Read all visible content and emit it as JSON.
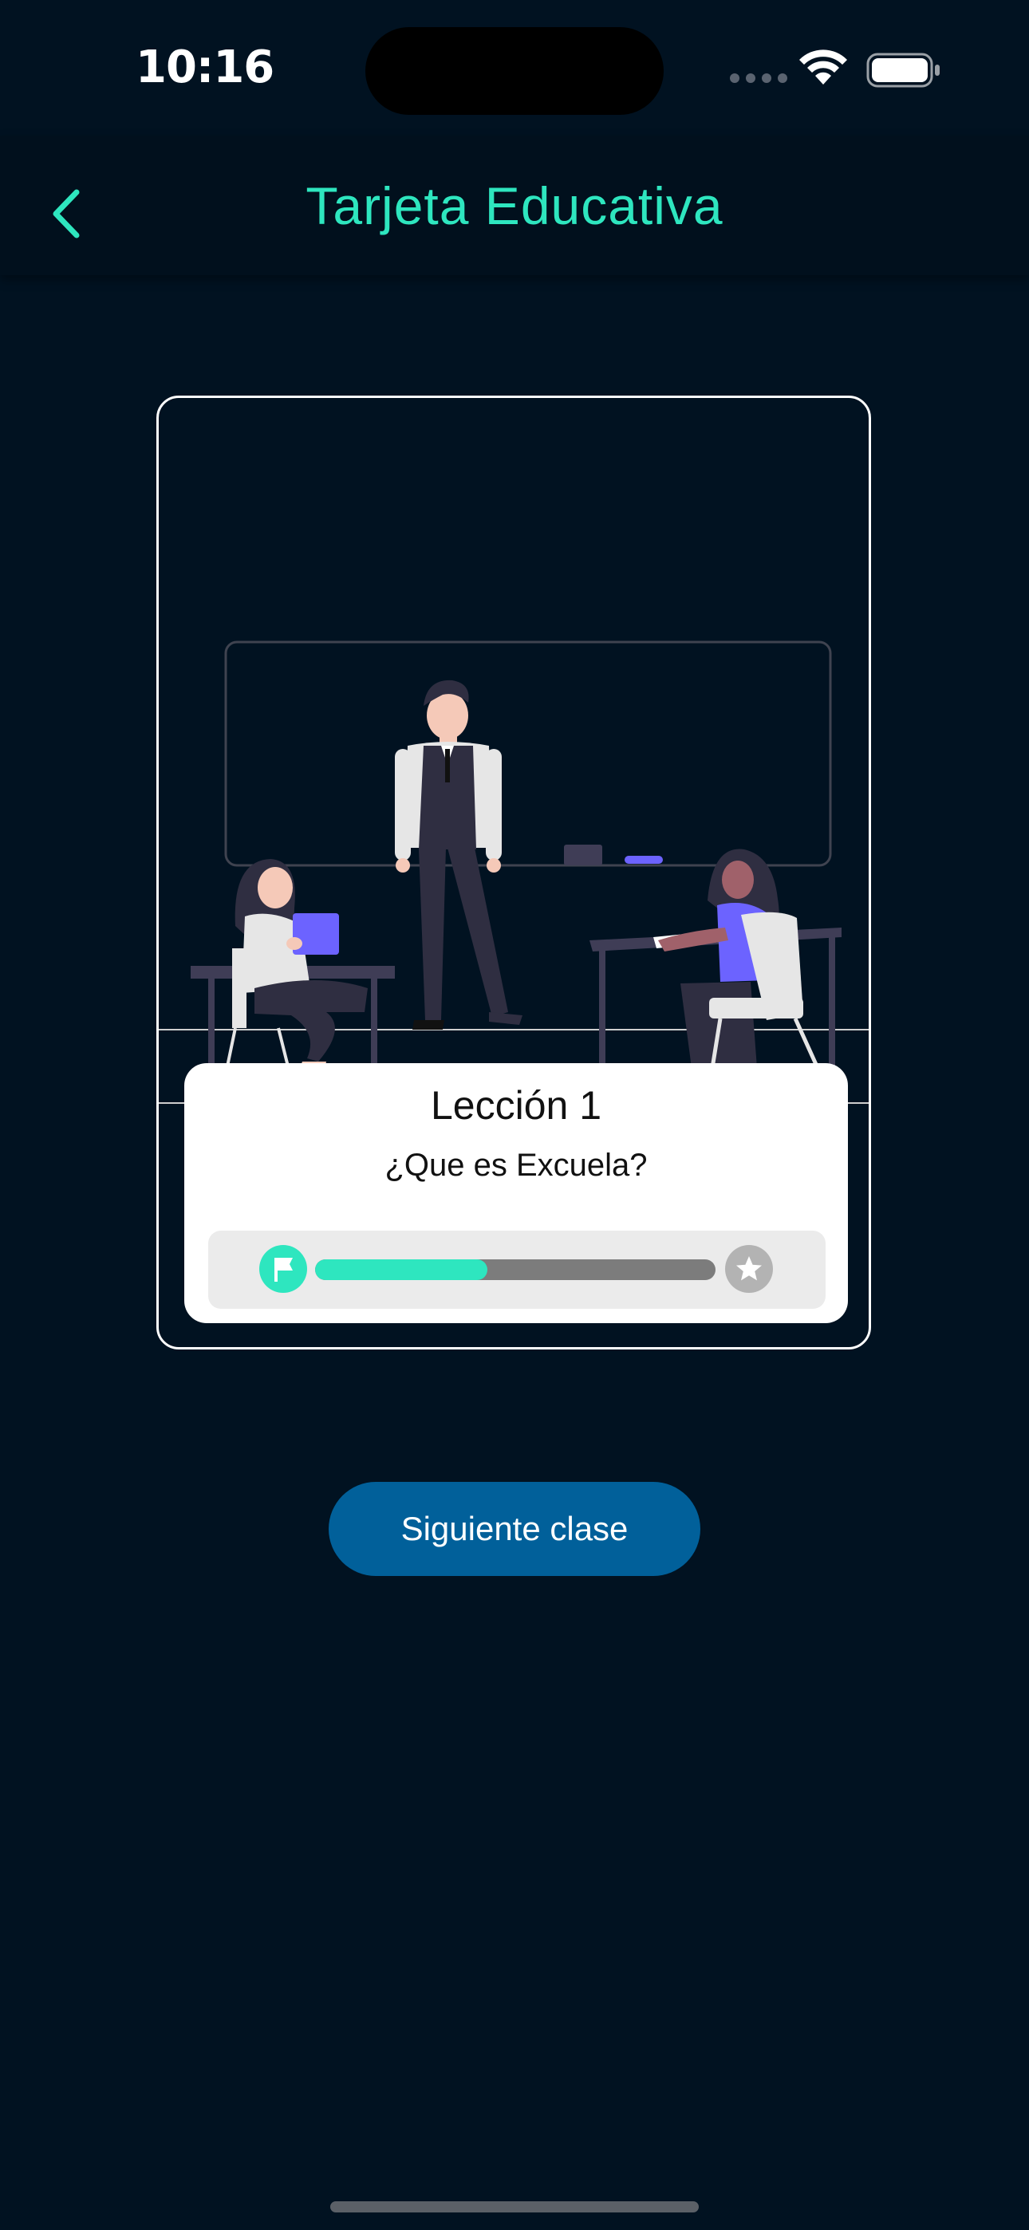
{
  "status_bar": {
    "time": "10:16",
    "wifi_icon": "wifi-icon",
    "battery_icon": "battery-icon"
  },
  "nav": {
    "back_icon": "chevron-left-icon",
    "title": "Tarjeta Educativa"
  },
  "card": {
    "illustration": "classroom-illustration",
    "lesson_title": "Lección 1",
    "lesson_subtitle": "¿Que es Excuela?",
    "progress": {
      "start_icon": "flag-icon",
      "end_icon": "star-icon",
      "fraction": 0.43
    }
  },
  "actions": {
    "next_label": "Siguiente clase"
  },
  "colors": {
    "background": "#011221",
    "accent": "#2EE6BF",
    "button": "#01609A",
    "card_panel": "#FFFFFF"
  }
}
